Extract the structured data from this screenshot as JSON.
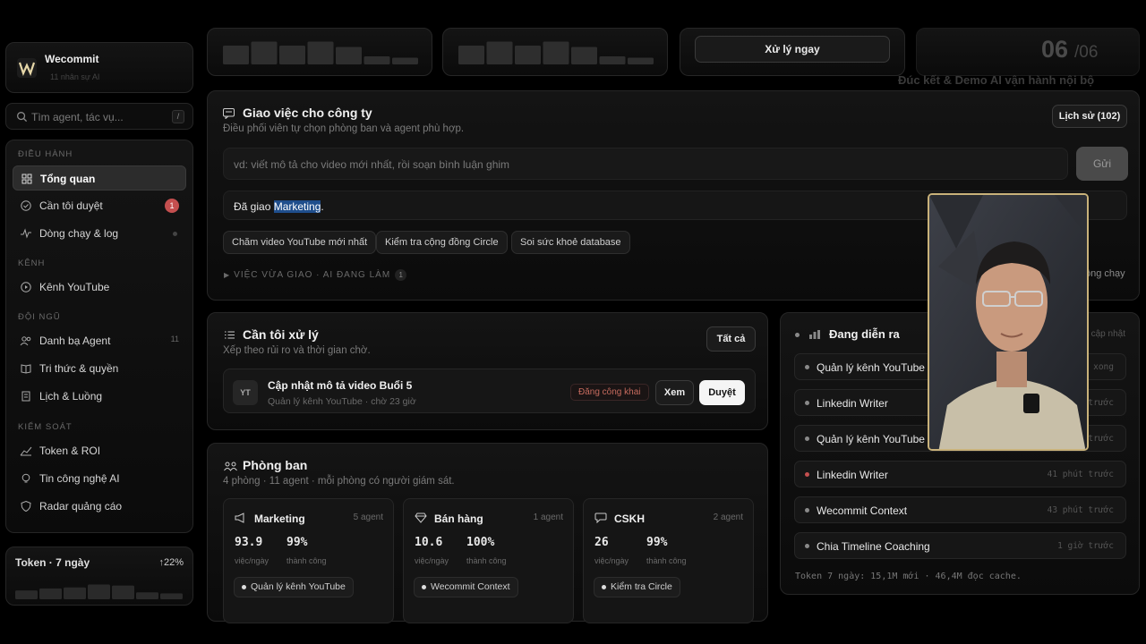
{
  "brand": {
    "name": "Wecommit",
    "subtitle": "11 nhân sự AI"
  },
  "search": {
    "placeholder": "Tìm agent, tác vụ...",
    "shortcut": "/"
  },
  "sidebar": {
    "sections": [
      {
        "title": "ĐIỀU HÀNH"
      },
      {
        "title": "KÊNH"
      },
      {
        "title": "ĐỘI NGŨ"
      },
      {
        "title": "KIỂM SOÁT"
      }
    ],
    "items": [
      {
        "label": "Tổng quan",
        "icon": "grid-icon"
      },
      {
        "label": "Cần tôi duyệt",
        "icon": "check-circle-icon",
        "badge": "1"
      },
      {
        "label": "Dòng chạy & log",
        "icon": "pulse-icon"
      },
      {
        "label": "Kênh YouTube",
        "icon": "play-icon"
      },
      {
        "label": "Danh bạ Agent",
        "icon": "users-icon",
        "count": "11"
      },
      {
        "label": "Tri thức & quyền",
        "icon": "book-icon"
      },
      {
        "label": "Lịch & Luồng",
        "icon": "document-icon"
      },
      {
        "label": "Token & ROI",
        "icon": "trend-icon"
      },
      {
        "label": "Tin công nghệ AI",
        "icon": "lightbulb-icon"
      },
      {
        "label": "Radar quảng cáo",
        "icon": "shield-icon"
      }
    ]
  },
  "token_week": {
    "title": "Token · 7 ngày",
    "change": "↑22%",
    "values": [
      0.45,
      0.55,
      0.6,
      0.75,
      0.7,
      0.35,
      0.3
    ]
  },
  "top": {
    "card1_values": [
      0.7,
      0.85,
      0.7,
      0.85,
      0.65,
      0.3,
      0.25
    ],
    "card2_values": [
      0.7,
      0.85,
      0.7,
      0.85,
      0.65,
      0.3,
      0.25
    ],
    "action": "Xử lý ngay"
  },
  "slide": {
    "current": "06",
    "total": "/06",
    "subtitle": "Đúc kết & Demo AI vận hành nội bộ"
  },
  "assign": {
    "title": "Giao việc cho công ty",
    "subtitle": "Điều phối viên tự chọn phòng ban và agent phù hợp.",
    "history": "Lịch sử (102)",
    "placeholder": "vd: viết mô tả cho video mới nhất, rồi soạn bình luận ghim",
    "send": "Gửi",
    "assigned_prefix": "Đã giao ",
    "assigned_dept": "Marketing",
    "assigned_suffix": ".",
    "chips": [
      "Chăm video YouTube mới nhất",
      "Kiểm tra cộng đồng Circle",
      "Soi sức khoẻ database"
    ],
    "recent_label": "VIỆC VỪA GIAO · AI ĐANG LÀM",
    "recent_count": "1",
    "running": "ông chạy"
  },
  "todo": {
    "title": "Cần tôi xử lý",
    "subtitle": "Xếp theo rủi ro và thời gian chờ.",
    "all": "Tất cả",
    "task": {
      "avatar": "YT",
      "title": "Cập nhật mô tả video Buổi 5",
      "meta": "Quản lý kênh YouTube · chờ 23 giờ",
      "tag": "Đăng công khai",
      "view": "Xem",
      "approve": "Duyệt"
    }
  },
  "dept": {
    "title": "Phòng ban",
    "subtitle": "4 phòng · 11 agent · mỗi phòng có người giám sát.",
    "cards": [
      {
        "name": "Marketing",
        "count": "5 agent",
        "v1": "93.9",
        "l1": "việc/ngày",
        "v2": "99%",
        "l2": "thành công",
        "agent": "Quản lý kênh YouTube",
        "icon": "megaphone-icon"
      },
      {
        "name": "Bán hàng",
        "count": "1 agent",
        "v1": "10.6",
        "l1": "việc/ngày",
        "v2": "100%",
        "l2": "thành công",
        "agent": "Wecommit Context",
        "icon": "diamond-icon"
      },
      {
        "name": "CSKH",
        "count": "2 agent",
        "v1": "26",
        "l1": "việc/ngày",
        "v2": "99%",
        "l2": "thành công",
        "agent": "Kiểm tra Circle",
        "icon": "chat-icon"
      }
    ]
  },
  "live": {
    "title": "Đang diễn ra",
    "updated": "cập nhật",
    "rows": [
      {
        "name": "Quản lý kênh YouTube",
        "time": "a xong",
        "status": "gray"
      },
      {
        "name": "Linkedin Writer",
        "time": "trước",
        "status": "gray"
      },
      {
        "name": "Quản lý kênh YouTube",
        "time": "trước",
        "status": "gray"
      },
      {
        "name": "Linkedin Writer",
        "time": "41 phút trước",
        "status": "red"
      },
      {
        "name": "Wecommit Context",
        "time": "43 phút trước",
        "status": "gray"
      },
      {
        "name": "Chia Timeline Coaching",
        "time": "1 giờ trước",
        "status": "gray"
      }
    ],
    "footer": "Token 7 ngày: 15,1M mới · 46,4M đọc cache."
  },
  "colors": {
    "accent_red": "#c44f4f",
    "highlight": "#1f4e8c",
    "frame_gold": "#c9b27a"
  }
}
